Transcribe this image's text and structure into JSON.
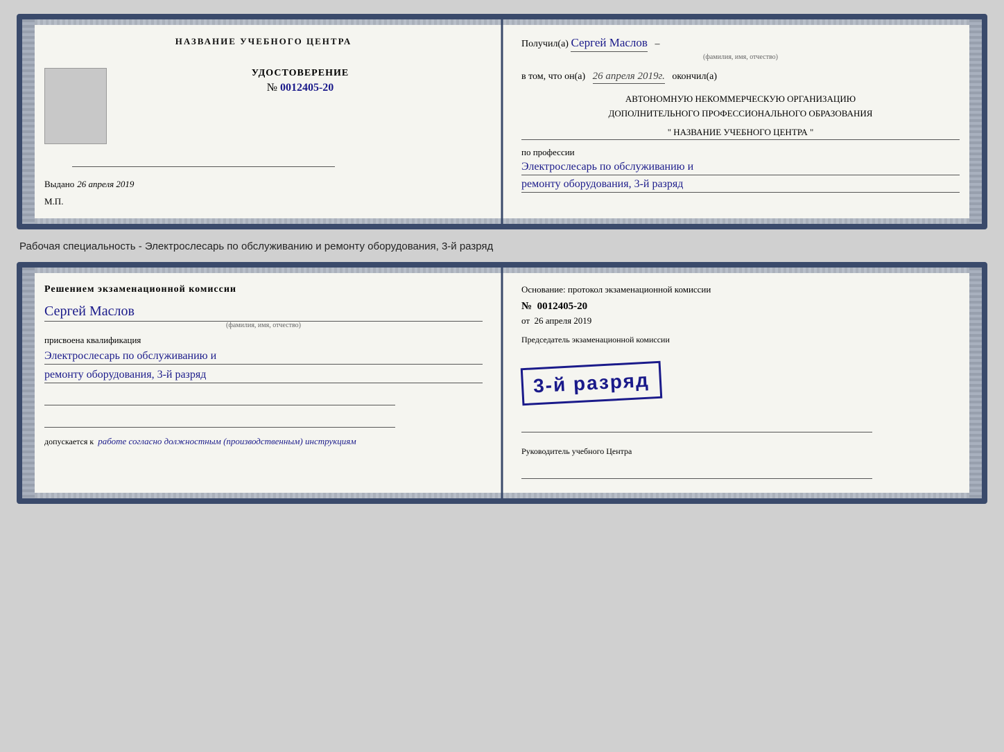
{
  "cert1": {
    "left": {
      "center_title": "НАЗВАНИЕ УЧЕБНОГО ЦЕНТРА",
      "udostoverenie_label": "УДОСТОВЕРЕНИЕ",
      "number_prefix": "№",
      "number": "0012405-20",
      "vydano_label": "Выдано",
      "vydano_date": "26 апреля 2019",
      "mp_label": "М.П."
    },
    "right": {
      "poluchil_prefix": "Получил(а)",
      "recipient_name": "Сергей Маслов",
      "fio_label": "(фамилия, имя, отчество)",
      "vtom_prefix": "в том, что он(а)",
      "date_completed": "26 апреля 2019г.",
      "okончил_suffix": "окончил(а)",
      "org_line1": "АВТОНОМНУЮ НЕКОММЕРЧЕСКУЮ ОРГАНИЗАЦИЮ",
      "org_line2": "ДОПОЛНИТЕЛЬНОГО ПРОФЕССИОНАЛЬНОГО ОБРАЗОВАНИЯ",
      "org_name": "\" НАЗВАНИЕ УЧЕБНОГО ЦЕНТРА \"",
      "po_professii_label": "по профессии",
      "profession_line1": "Электрослесарь по обслуживанию и",
      "profession_line2": "ремонту оборудования, 3-й разряд"
    }
  },
  "description": "Рабочая специальность - Электрослесарь по обслуживанию и ремонту оборудования, 3-й разряд",
  "cert2": {
    "left": {
      "resheniem_label": "Решением экзаменационной комиссии",
      "name": "Сергей Маслов",
      "fio_label": "(фамилия, имя, отчество)",
      "prisvoena_label": "присвоена квалификация",
      "qualification_line1": "Электрослесарь по обслуживанию и",
      "qualification_line2": "ремонту оборудования, 3-й разряд",
      "dopuskaetsya_prefix": "допускается к",
      "dopusk_text": "работе согласно должностным (производственным) инструкциям"
    },
    "right": {
      "osnovanie_label": "Основание: протокол экзаменационной комиссии",
      "number_prefix": "№",
      "number": "0012405-20",
      "ot_prefix": "от",
      "ot_date": "26 апреля 2019",
      "stamp_text": "3-й разряд",
      "predsedatel_label": "Председатель экзаменационной комиссии",
      "rukovoditel_label": "Руководитель учебного Центра"
    }
  }
}
